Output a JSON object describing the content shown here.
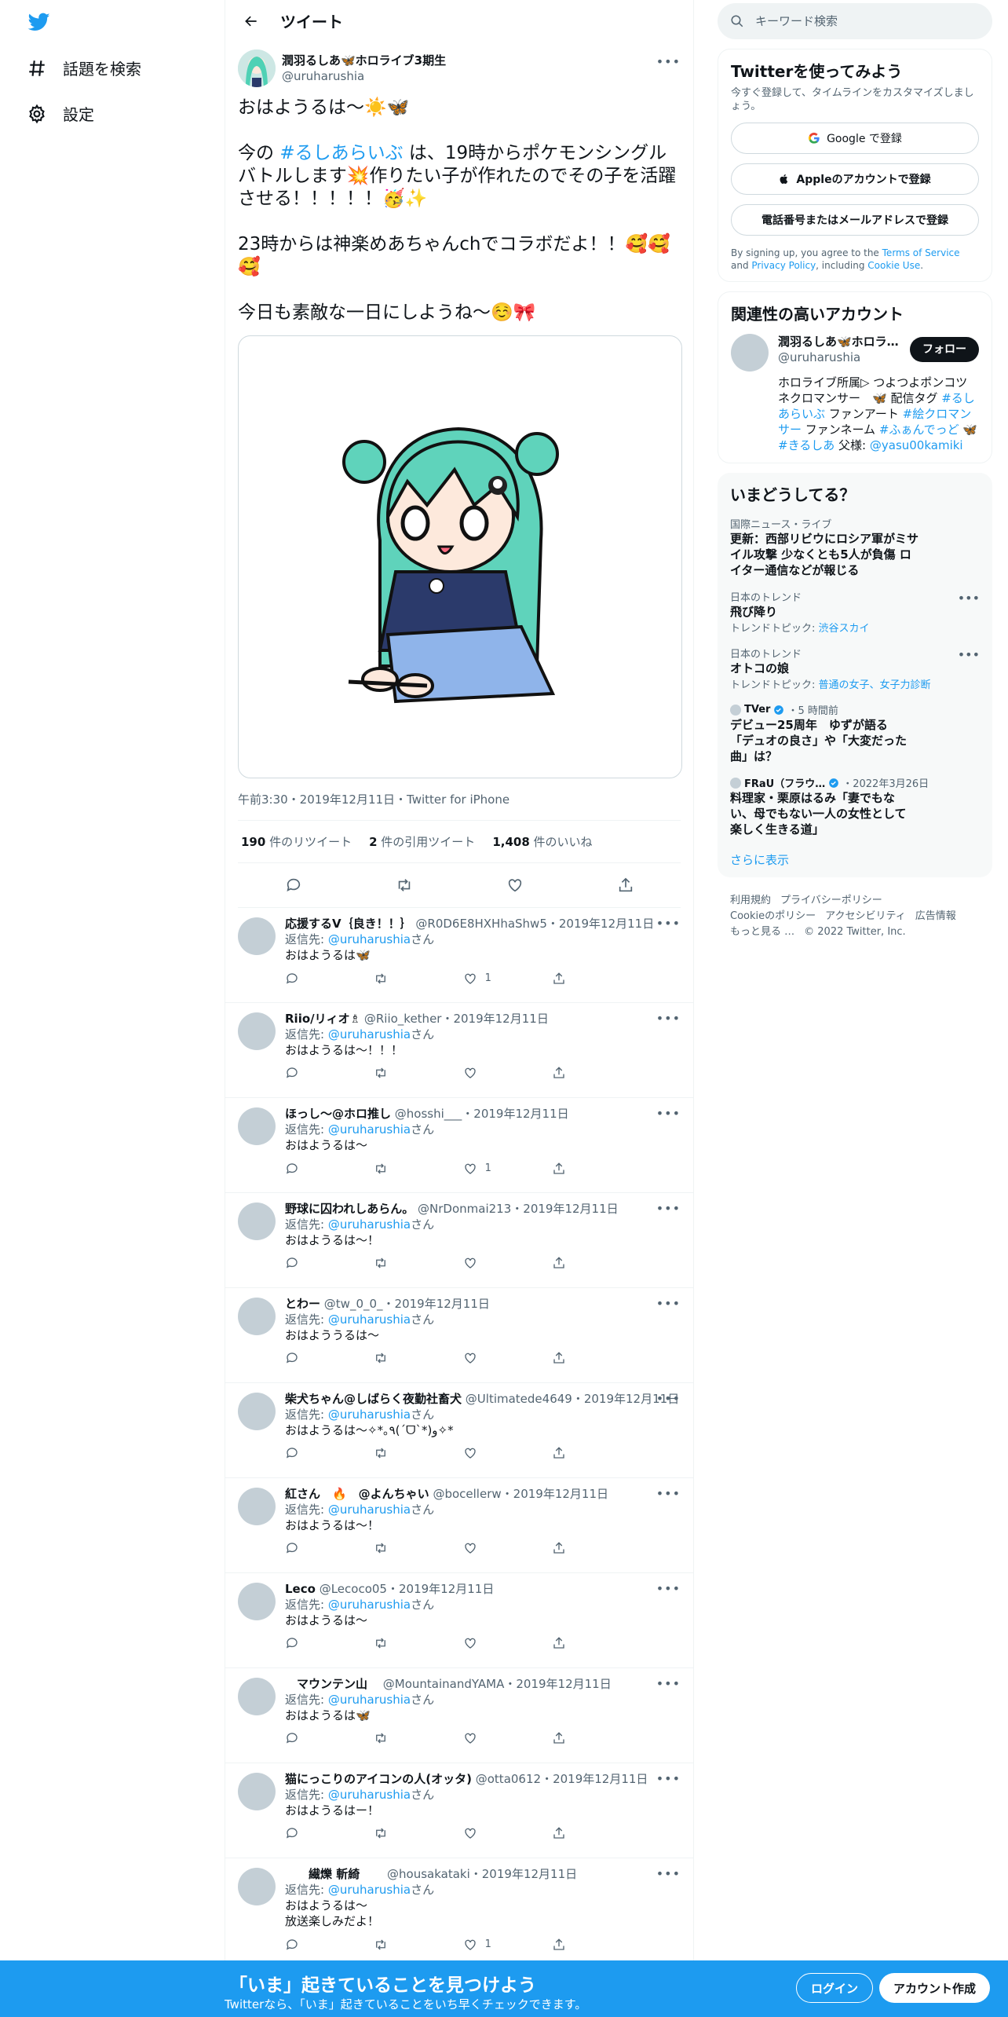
{
  "colors": {
    "accent": "#1d9bf0",
    "text": "#0f1419",
    "muted": "#536471",
    "banner": "#1d9bf0"
  },
  "nav": {
    "logo_icon": "twitter-bird-icon",
    "items": [
      {
        "label": "話題を検索",
        "icon": "hashtag-icon"
      },
      {
        "label": "設定",
        "icon": "gear-icon"
      }
    ]
  },
  "header": {
    "title": "ツイート",
    "back_icon": "arrow-left-icon"
  },
  "tweet": {
    "author_name": "潤羽るしあ🦋ホロライブ3期生",
    "author_handle": "@uruharushia",
    "text_line1": "おはようるは～☀️🦋",
    "text_p2_before": "今の ",
    "hashtag": "#るしあらいぶ",
    "text_p2_after": " は、19時からポケモンシングルバトルします💥作りたい子が作れたのでその子を活躍させる！！！！！🥳✨",
    "text_p3": "23時からは神楽めあちゃんchでコラボだよ！！🥰🥰🥰",
    "text_p4": "今日も素敵な一日にしようね～☺️🎀",
    "meta": "午前3:30・2019年12月11日・Twitter for iPhone",
    "retweets_count": "190",
    "retweets_label": " 件のリツイート",
    "quotes_count": "2",
    "quotes_label": " 件の引用ツイート",
    "likes_count": "1,408",
    "likes_label": " 件のいいね"
  },
  "replies": [
    {
      "name": "応援するV｛良き！！｝",
      "handle": "@R0D6E8HXHhaShw5",
      "date": "・2019年12月11日",
      "reply_to_label": "返信先: ",
      "reply_to": "@uruharushia",
      "reply_to_suffix": "さん",
      "text": "おはようるは🦋",
      "likes": "1"
    },
    {
      "name": "Riio/リィオ♗",
      "handle": "@Riio_kether",
      "date": "・2019年12月11日",
      "reply_to_label": "返信先: ",
      "reply_to": "@uruharushia",
      "reply_to_suffix": "さん",
      "text": "おはようるは～！！！",
      "likes": ""
    },
    {
      "name": "ほっし～@ホロ推し",
      "handle": "@hosshi___",
      "date": "・2019年12月11日",
      "reply_to_label": "返信先: ",
      "reply_to": "@uruharushia",
      "reply_to_suffix": "さん",
      "text": "おはようるは〜",
      "likes": "1"
    },
    {
      "name": "野球に囚われしあらん。",
      "handle": "@NrDonmai213",
      "date": "・2019年12月11日",
      "reply_to_label": "返信先: ",
      "reply_to": "@uruharushia",
      "reply_to_suffix": "さん",
      "text": "おはようるは〜！",
      "likes": ""
    },
    {
      "name": "とわー",
      "handle": "@tw_0_0_",
      "date": "・2019年12月11日",
      "reply_to_label": "返信先: ",
      "reply_to": "@uruharushia",
      "reply_to_suffix": "さん",
      "text": "おはよううるは～",
      "likes": ""
    },
    {
      "name": "柴犬ちゃん@しばらく夜勤社畜犬",
      "handle": "@Ultimatede4649",
      "date": "・2019年12月11日",
      "reply_to_label": "返信先: ",
      "reply_to": "@uruharushia",
      "reply_to_suffix": "さん",
      "text": "おはようるは〜✧*｡٩(ˊᗜˋ*)و✧*",
      "likes": ""
    },
    {
      "name": "紅さん　🔥　@よんちゃい",
      "handle": "@bocellerw",
      "date": "・2019年12月11日",
      "reply_to_label": "返信先: ",
      "reply_to": "@uruharushia",
      "reply_to_suffix": "さん",
      "text": "おはようるは～！",
      "likes": ""
    },
    {
      "name": "Leco",
      "handle": "@Lecoco05",
      "date": "・2019年12月11日",
      "reply_to_label": "返信先: ",
      "reply_to": "@uruharushia",
      "reply_to_suffix": "さん",
      "text": "おはようるは～",
      "likes": ""
    },
    {
      "name": "　マウンテン山　",
      "handle": "@MountainandYAMA",
      "date": "・2019年12月11日",
      "reply_to_label": "返信先: ",
      "reply_to": "@uruharushia",
      "reply_to_suffix": "さん",
      "text": "おはようるは🦋",
      "likes": ""
    },
    {
      "name": "猫にっこりのアイコンの人(オッタ)",
      "handle": "@otta0612",
      "date": "・2019年12月11日",
      "reply_to_label": "返信先: ",
      "reply_to": "@uruharushia",
      "reply_to_suffix": "さん",
      "text": "おはようるはー！",
      "likes": ""
    },
    {
      "name": "　　繊爍 斬綺　　",
      "handle": "@housakataki",
      "date": "・2019年12月11日",
      "reply_to_label": "返信先: ",
      "reply_to": "@uruharushia",
      "reply_to_suffix": "さん",
      "text": "おはようるは～\n放送楽しみだよ！",
      "likes": "1"
    }
  ],
  "right": {
    "search_placeholder": "キーワード検索",
    "signup_panel": {
      "title": "Twitterを使ってみよう",
      "subtitle": "今すぐ登録して、タイムラインをカスタマイズしましょう。",
      "google_label": "Google で登録",
      "apple_label": "Appleのアカウントで登録",
      "phone_label": "電話番号またはメールアドレスで登録",
      "terms_prefix": "By signing up, you agree to the ",
      "terms_link": "Terms of Service",
      "terms_and": " and ",
      "privacy_link": "Privacy Policy",
      "terms_including": ", including ",
      "cookie_link": "Cookie Use",
      "terms_end": "."
    },
    "related": {
      "title": "関連性の高いアカウント",
      "name": "潤羽るしあ🦋ホロラ…",
      "handle": "@uruharushia",
      "follow_label": "フォロー",
      "bio_1": "ホロライブ所属▷ つよつよポンコツネクロマンサー　🦋 配信タグ ",
      "bio_tag1": "#るしあらいぶ",
      "bio_2": " ファンアート ",
      "bio_tag2": "#絵クロマンサー",
      "bio_3": " ファンネーム ",
      "bio_tag3": "#ふぁんでっど",
      "bio_4": " 🦋 ",
      "bio_tag4": "#きるしあ",
      "bio_5": " 父様: ",
      "bio_mention": "@yasu00kamiki"
    },
    "trends": {
      "title": "いまどうしてる？",
      "items": [
        {
          "category": "国際ニュース・ライブ",
          "title": "更新：西部リビウにロシア軍がミサイル攻撃 少なくとも5人が負傷 ロイター通信などが報じる",
          "sub_label": "",
          "sub_link": ""
        },
        {
          "category": "日本のトレンド",
          "title": "飛び降り",
          "sub_label": "トレンドトピック: ",
          "sub_link": "渋谷スカイ"
        },
        {
          "category": "日本のトレンド",
          "title": "オトコの娘",
          "sub_label": "トレンドトピック: ",
          "sub_link": "普通の女子、女子力診断"
        },
        {
          "category": "TVer",
          "title": "デビュー25周年　ゆずが語る「デュオの良さ」や「大変だった曲」は？",
          "sub_label": "・5 時間前",
          "sub_link": ""
        },
        {
          "category": "FRaU（フラウ…",
          "title": "料理家・栗原はるみ「妻でもない、母でもない一人の女性として楽しく生きる道」",
          "sub_label": "・2022年3月26日",
          "sub_link": ""
        }
      ],
      "show_more": "さらに表示"
    },
    "footer": {
      "links": [
        "利用規約",
        "プライバシーポリシー",
        "Cookieのポリシー",
        "アクセシビリティ",
        "広告情報",
        "もっと見る …"
      ],
      "copyright": "© 2022 Twitter, Inc."
    }
  },
  "banner": {
    "title": "「いま」起きていることを見つけよう",
    "subtitle": "Twitterなら、「いま」起きていることをいち早くチェックできます。",
    "login_label": "ログイン",
    "signup_label": "アカウント作成"
  }
}
